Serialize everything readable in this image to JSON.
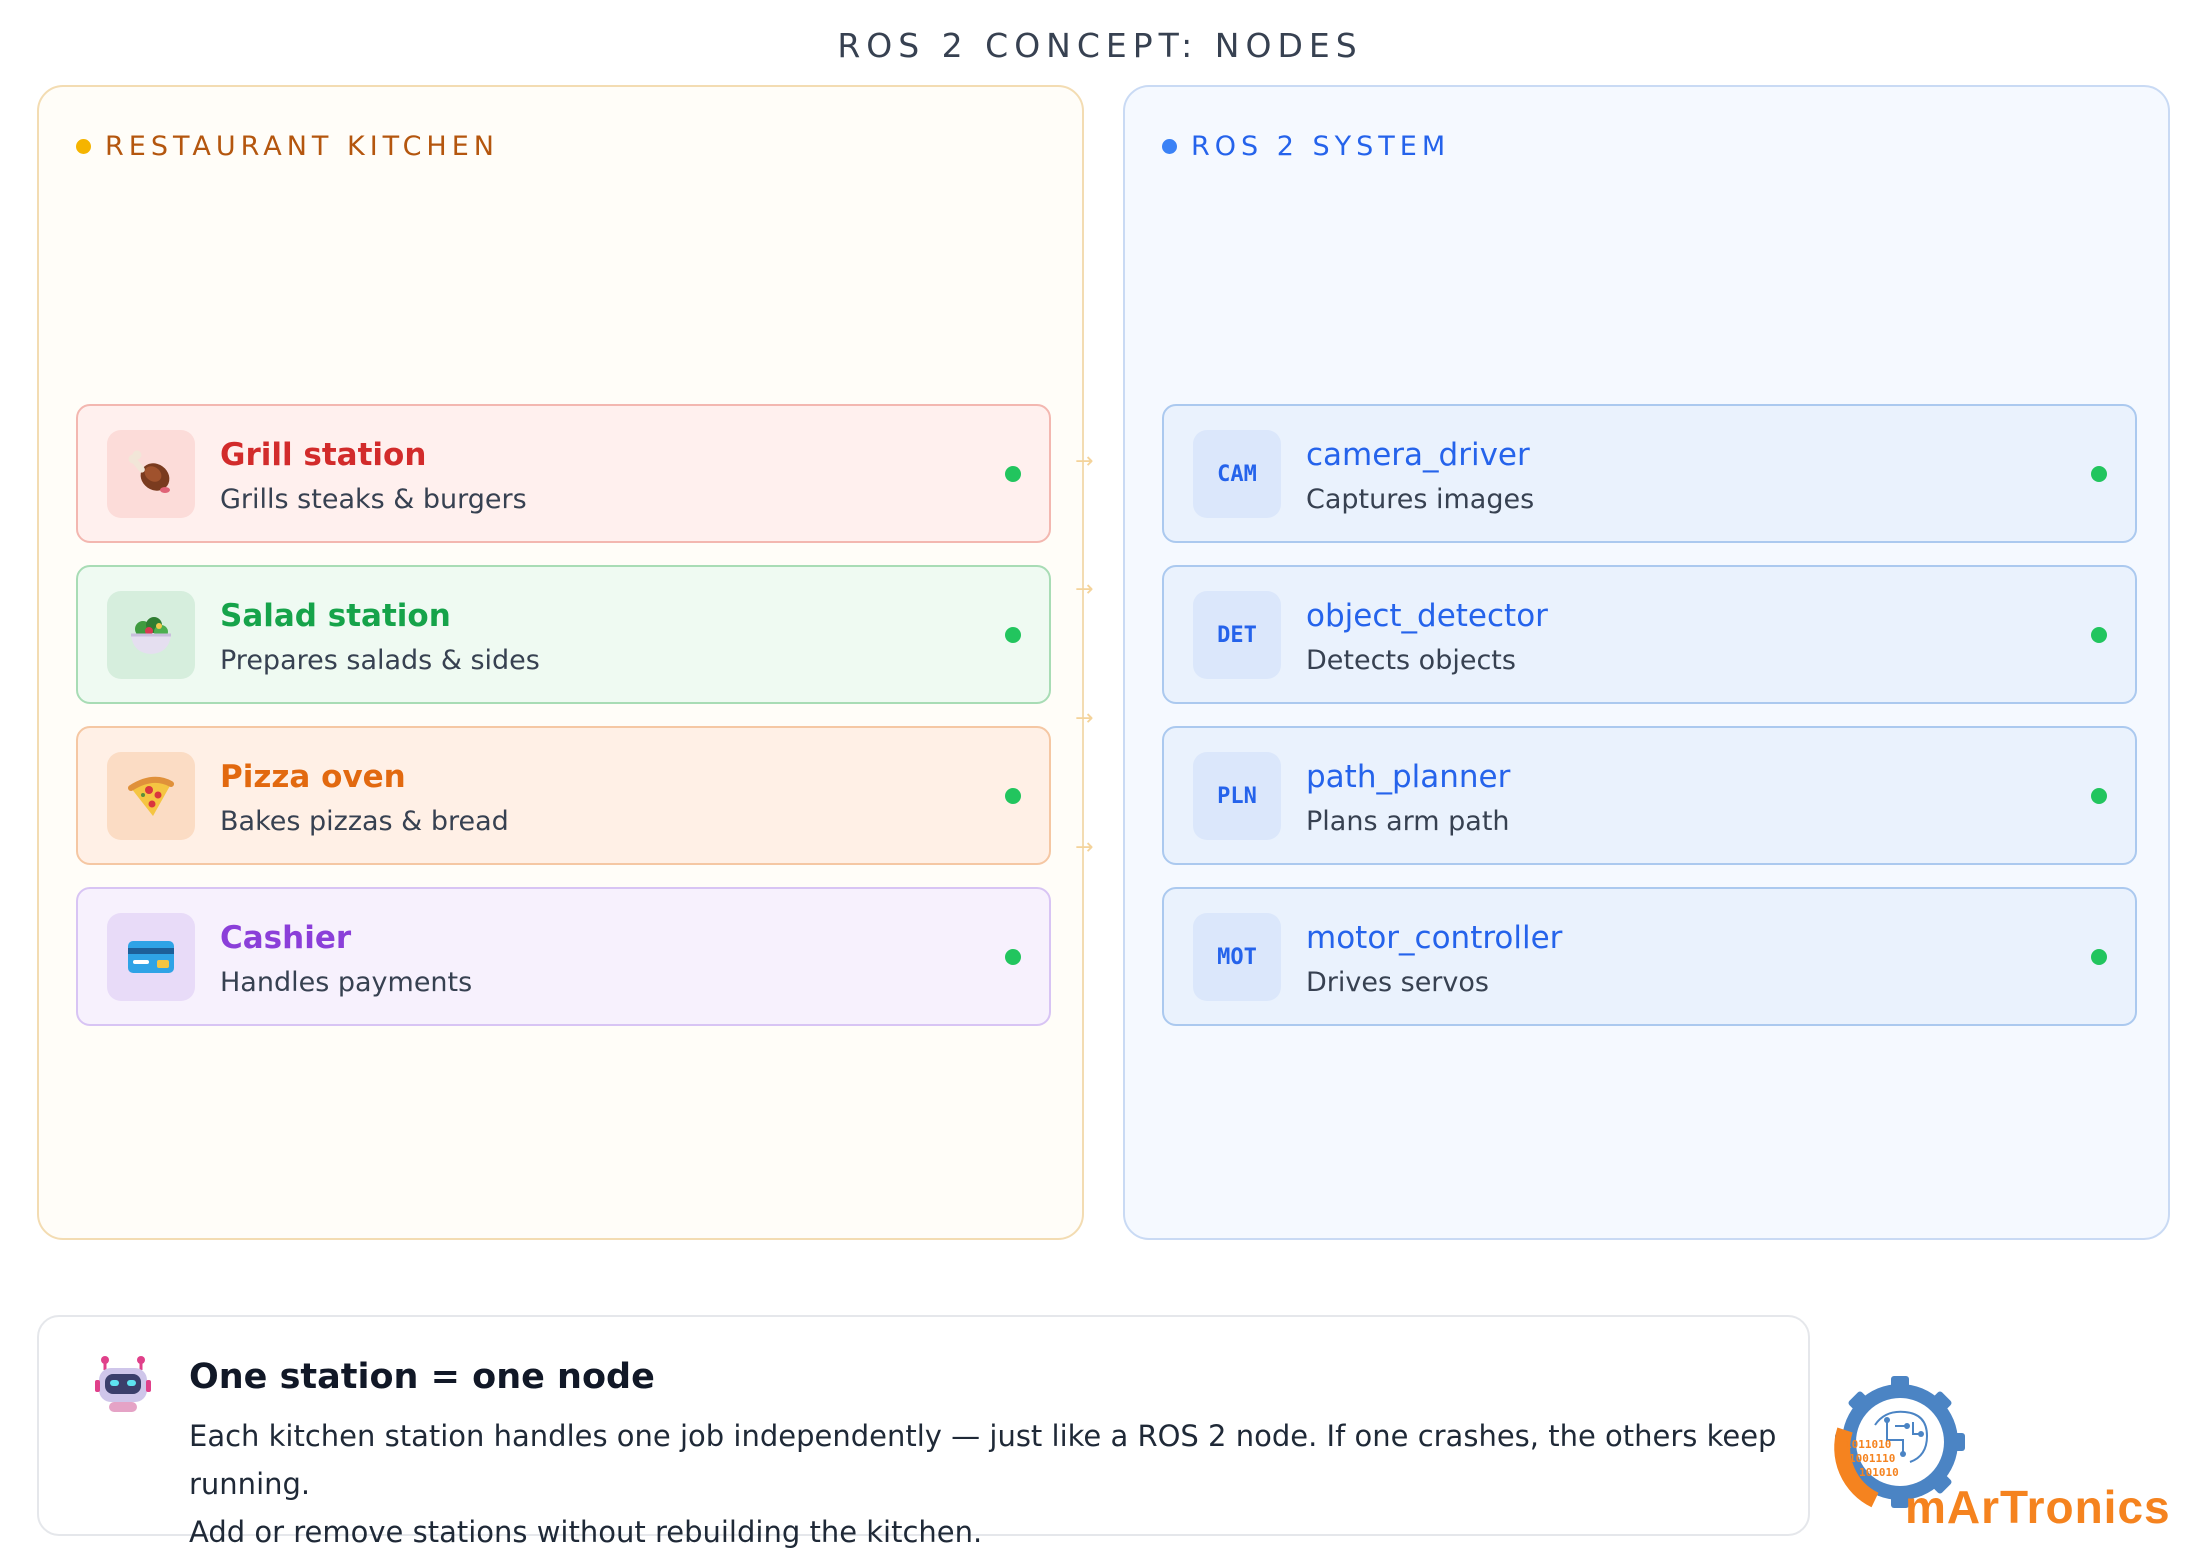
{
  "page": {
    "title": "ROS 2 CONCEPT: NODES"
  },
  "kitchen": {
    "header": "RESTAURANT KITCHEN",
    "stations": [
      {
        "icon": "meat-on-bone-icon",
        "title": "Grill station",
        "subtitle": "Grills steaks & burgers",
        "accent": "#d22b2b"
      },
      {
        "icon": "salad-bowl-icon",
        "title": "Salad station",
        "subtitle": "Prepares salads & sides",
        "accent": "#16a34a"
      },
      {
        "icon": "pizza-slice-icon",
        "title": "Pizza oven",
        "subtitle": "Bakes pizzas & bread",
        "accent": "#e2690f"
      },
      {
        "icon": "credit-card-icon",
        "title": "Cashier",
        "subtitle": "Handles payments",
        "accent": "#8b3fd9"
      }
    ]
  },
  "ros": {
    "header": "ROS 2 SYSTEM",
    "nodes": [
      {
        "code": "CAM",
        "title": "camera_driver",
        "subtitle": "Captures images"
      },
      {
        "code": "DET",
        "title": "object_detector",
        "subtitle": "Detects objects"
      },
      {
        "code": "PLN",
        "title": "path_planner",
        "subtitle": "Plans arm path"
      },
      {
        "code": "MOT",
        "title": "motor_controller",
        "subtitle": "Drives servos"
      }
    ],
    "accent": "#2563eb",
    "status_color": "#22c55e"
  },
  "note": {
    "icon": "robot-icon",
    "title": "One station = one node",
    "body_line1": "Each kitchen station handles one job independently — just like a ROS 2 node. If one crashes, the others keep running.",
    "body_line2": "Add or remove stations without rebuilding the kitchen."
  },
  "logo": {
    "text": "mArTronics",
    "binary": [
      "1011010",
      "1001110",
      "101010"
    ]
  }
}
